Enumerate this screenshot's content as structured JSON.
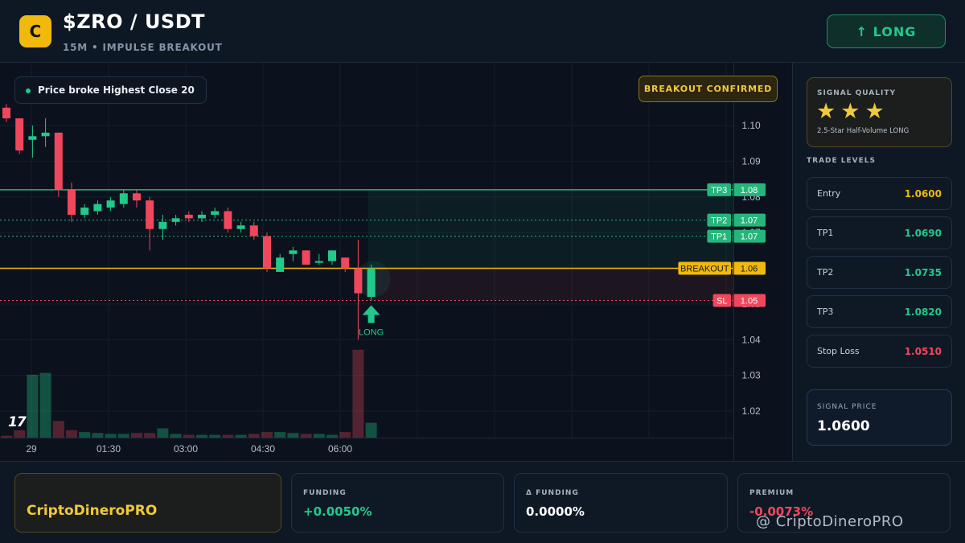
{
  "header": {
    "logo_letter": "C",
    "pair": "$ZRO / USDT",
    "subtitle": "15M • IMPULSE BREAKOUT",
    "long_button": "↑ LONG"
  },
  "chart": {
    "hint": "Price broke Highest Close 20",
    "confirm_badge": "BREAKOUT CONFIRMED",
    "long_marker_label": "LONG",
    "tv_logo": "17",
    "price_axis": [
      "1.10",
      "1.09",
      "1.08",
      "1.07",
      "1.06",
      "1.05",
      "1.04",
      "1.03",
      "1.02"
    ],
    "time_axis": [
      "29",
      "01:30",
      "03:00",
      "04:30",
      "06:00"
    ],
    "levels": [
      {
        "tag": "TP3",
        "value": "1.08",
        "price": 1.082,
        "color": "#26b67c",
        "style": "solid"
      },
      {
        "tag": "TP2",
        "value": "1.07",
        "price": 1.0735,
        "color": "#26b67c",
        "style": "dotted"
      },
      {
        "tag": "TP1",
        "value": "1.07",
        "price": 1.069,
        "color": "#26b67c",
        "style": "dotted"
      },
      {
        "tag": "",
        "value": "1.06",
        "price": 1.06,
        "color": "#26b67c",
        "style": "none"
      },
      {
        "tag": "BREAKOUT",
        "value": "1.06",
        "price": 1.06,
        "color": "#f0b90b",
        "style": "solid"
      },
      {
        "tag": "SL",
        "value": "1.05",
        "price": 1.051,
        "color": "#f0475c",
        "style": "dotted"
      }
    ],
    "colors": {
      "up": "#22c98a",
      "down": "#f0475c",
      "breakout": "#f0b90b"
    }
  },
  "chart_data": {
    "type": "candlestick",
    "x": [
      "29",
      "01:30",
      "03:00",
      "04:30",
      "06:00"
    ],
    "y_ticks": [
      1.1,
      1.09,
      1.08,
      1.07,
      1.06,
      1.05,
      1.04,
      1.03,
      1.02
    ],
    "candles": [
      {
        "o": 1.105,
        "h": 1.106,
        "l": 1.101,
        "c": 1.102
      },
      {
        "o": 1.102,
        "h": 1.102,
        "l": 1.092,
        "c": 1.093
      },
      {
        "o": 1.096,
        "h": 1.1,
        "l": 1.091,
        "c": 1.097
      },
      {
        "o": 1.097,
        "h": 1.102,
        "l": 1.094,
        "c": 1.098
      },
      {
        "o": 1.098,
        "h": 1.098,
        "l": 1.08,
        "c": 1.082
      },
      {
        "o": 1.082,
        "h": 1.084,
        "l": 1.073,
        "c": 1.075
      },
      {
        "o": 1.075,
        "h": 1.078,
        "l": 1.074,
        "c": 1.077
      },
      {
        "o": 1.076,
        "h": 1.079,
        "l": 1.075,
        "c": 1.078
      },
      {
        "o": 1.077,
        "h": 1.08,
        "l": 1.076,
        "c": 1.079
      },
      {
        "o": 1.078,
        "h": 1.082,
        "l": 1.077,
        "c": 1.081
      },
      {
        "o": 1.081,
        "h": 1.082,
        "l": 1.077,
        "c": 1.079
      },
      {
        "o": 1.079,
        "h": 1.08,
        "l": 1.065,
        "c": 1.071
      },
      {
        "o": 1.071,
        "h": 1.075,
        "l": 1.068,
        "c": 1.073
      },
      {
        "o": 1.073,
        "h": 1.075,
        "l": 1.072,
        "c": 1.074
      },
      {
        "o": 1.075,
        "h": 1.076,
        "l": 1.073,
        "c": 1.074
      },
      {
        "o": 1.074,
        "h": 1.076,
        "l": 1.073,
        "c": 1.075
      },
      {
        "o": 1.075,
        "h": 1.077,
        "l": 1.074,
        "c": 1.076
      },
      {
        "o": 1.076,
        "h": 1.077,
        "l": 1.07,
        "c": 1.071
      },
      {
        "o": 1.071,
        "h": 1.073,
        "l": 1.07,
        "c": 1.072
      },
      {
        "o": 1.072,
        "h": 1.073,
        "l": 1.068,
        "c": 1.069
      },
      {
        "o": 1.069,
        "h": 1.07,
        "l": 1.059,
        "c": 1.06
      },
      {
        "o": 1.059,
        "h": 1.064,
        "l": 1.059,
        "c": 1.063
      },
      {
        "o": 1.064,
        "h": 1.066,
        "l": 1.062,
        "c": 1.065
      },
      {
        "o": 1.065,
        "h": 1.065,
        "l": 1.061,
        "c": 1.061
      },
      {
        "o": 1.062,
        "h": 1.064,
        "l": 1.061,
        "c": 1.062
      },
      {
        "o": 1.062,
        "h": 1.065,
        "l": 1.061,
        "c": 1.065
      },
      {
        "o": 1.063,
        "h": 1.063,
        "l": 1.059,
        "c": 1.06
      },
      {
        "o": 1.06,
        "h": 1.068,
        "l": 1.04,
        "c": 1.053
      },
      {
        "o": 1.052,
        "h": 1.061,
        "l": 1.051,
        "c": 1.06
      }
    ],
    "volumes": [
      0.02,
      0.08,
      0.68,
      0.7,
      0.18,
      0.08,
      0.06,
      0.05,
      0.04,
      0.04,
      0.05,
      0.05,
      0.1,
      0.04,
      0.03,
      0.03,
      0.03,
      0.03,
      0.03,
      0.04,
      0.06,
      0.06,
      0.05,
      0.04,
      0.04,
      0.03,
      0.06,
      0.95,
      0.16
    ],
    "levels": {
      "tp3": 1.082,
      "tp2": 1.0735,
      "tp1": 1.069,
      "breakout": 1.06,
      "sl": 1.051
    }
  },
  "signal_quality": {
    "title": "SIGNAL QUALITY",
    "stars": [
      "★",
      "★",
      "★"
    ],
    "description": "2.5-Star Half-Volume LONG"
  },
  "trade_levels": {
    "title": "TRADE LEVELS",
    "rows": [
      {
        "label": "Entry",
        "value": "1.0600",
        "color": "#f0b90b"
      },
      {
        "label": "TP1",
        "value": "1.0690",
        "color": "#22c98a"
      },
      {
        "label": "TP2",
        "value": "1.0735",
        "color": "#22c98a"
      },
      {
        "label": "TP3",
        "value": "1.0820",
        "color": "#22c98a"
      },
      {
        "label": "Stop Loss",
        "value": "1.0510",
        "color": "#f0475c"
      }
    ]
  },
  "signal_price": {
    "title": "SIGNAL PRICE",
    "value": "1.0600"
  },
  "footer": {
    "brand": "CriptoDineroPRO",
    "funding": {
      "label": "FUNDING",
      "value": "+0.0050%",
      "color": "#22c98a"
    },
    "delta_funding": {
      "label": "Δ FUNDING",
      "value": "0.0000%",
      "color": "#ffffff"
    },
    "premium": {
      "label": "PREMIUM",
      "value": "-0.0073%",
      "color": "#f0475c"
    },
    "watermark": "@ CriptoDineroPRO"
  }
}
